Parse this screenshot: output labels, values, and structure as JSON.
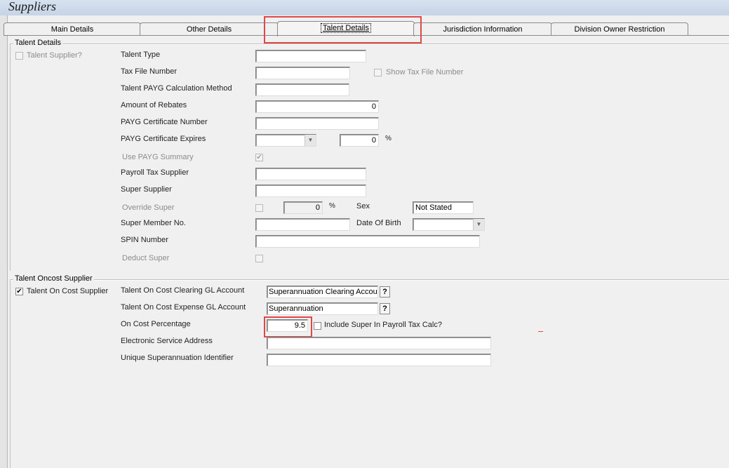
{
  "window": {
    "title": "Suppliers"
  },
  "tabs": [
    {
      "label": "Main Details"
    },
    {
      "label": "Other Details"
    },
    {
      "label": "Talent Details"
    },
    {
      "label": "Jurisdiction Information"
    },
    {
      "label": "Division Owner Restriction"
    }
  ],
  "talent_details": {
    "group_title": "Talent Details",
    "talent_supplier_label": "Talent Supplier?",
    "talent_type_label": "Talent Type",
    "talent_type_value": "",
    "tax_file_number_label": "Tax File Number",
    "tax_file_number_value": "",
    "show_tax_file_number_label": "Show Tax File Number",
    "payg_method_label": "Talent PAYG Calculation Method",
    "payg_method_value": "",
    "amount_of_rebates_label": "Amount of Rebates",
    "amount_of_rebates_value": "0",
    "payg_cert_number_label": "PAYG Certificate Number",
    "payg_cert_number_value": "",
    "payg_cert_expires_label": "PAYG Certificate Expires",
    "payg_cert_expires_value": "  /   /",
    "payg_percent_value": "0",
    "percent_symbol": "%",
    "use_payg_summary_label": "Use PAYG Summary",
    "use_payg_summary_checked": "✔",
    "payroll_tax_supplier_label": "Payroll Tax Supplier",
    "payroll_tax_supplier_value": "",
    "super_supplier_label": "Super Supplier",
    "super_supplier_value": "",
    "override_super_label": "Override Super",
    "override_super_value": "0",
    "sex_label": "Sex",
    "sex_value": "Not Stated",
    "super_member_no_label": "Super Member No.",
    "super_member_no_value": "",
    "date_of_birth_label": "Date Of Birth",
    "date_of_birth_value": "  /   /",
    "spin_number_label": "SPIN Number",
    "spin_number_value": "",
    "deduct_super_label": "Deduct Super"
  },
  "oncost": {
    "group_title": "Talent Oncost Supplier",
    "talent_on_cost_supplier_label": "Talent On Cost Supplier",
    "talent_on_cost_supplier_checked": "✔",
    "clearing_gl_label": "Talent On Cost Clearing GL Account",
    "clearing_gl_value": "Superannuation Clearing Accour",
    "expense_gl_label": "Talent On Cost Expense GL Account",
    "expense_gl_value": "Superannuation",
    "help_symbol": "?",
    "on_cost_percentage_label": "On Cost Percentage",
    "on_cost_percentage_value": "9.5",
    "include_super_label": "Include Super In Payroll Tax Calc?",
    "electronic_service_address_label": "Electronic Service Address",
    "electronic_service_address_value": "",
    "usi_label": "Unique Superannuation Identifier",
    "usi_value": ""
  },
  "colors": {
    "highlight_border": "#e04848",
    "title_bar": "#c6d3e6",
    "disabled_text": "#8c8c8c"
  }
}
